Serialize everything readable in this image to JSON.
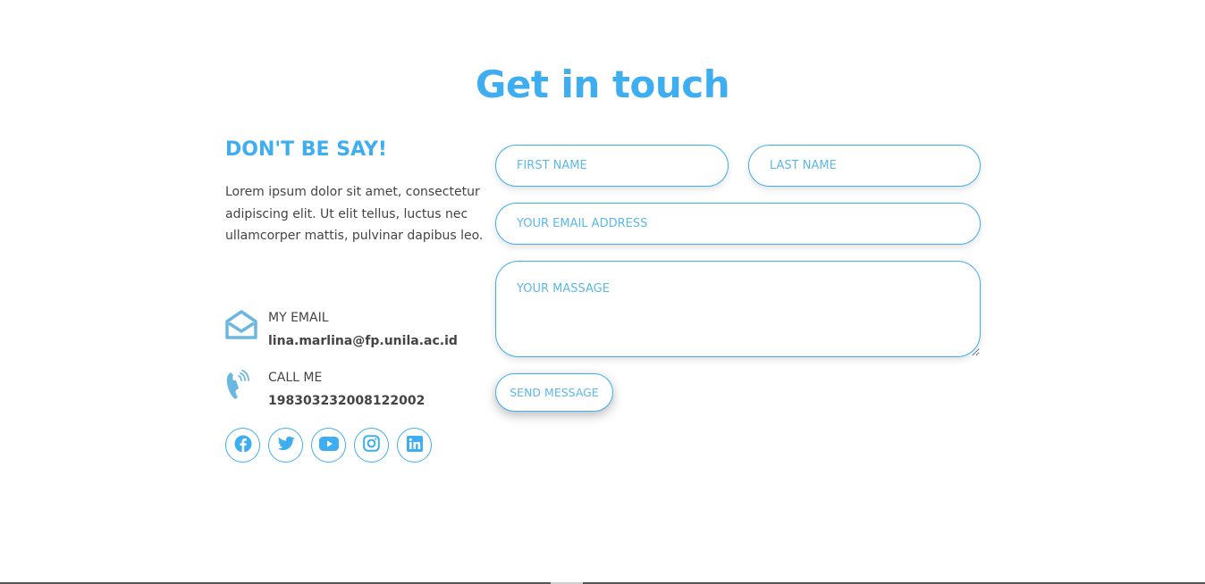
{
  "section": {
    "title": "Get in touch"
  },
  "left": {
    "heading": "DON'T BE SAY!",
    "body": "Lorem ipsum dolor sit amet, consectetur adipiscing elit. Ut elit tellus, luctus nec ullamcorper mattis, pulvinar dapibus leo.",
    "email_label": "MY EMAIL",
    "email_value": "lina.marlina@fp.unila.ac.id",
    "phone_label": "CALL ME",
    "phone_value": "198303232008122002",
    "socials": [
      "facebook-icon",
      "twitter-icon",
      "youtube-icon",
      "instagram-icon",
      "linkedin-icon"
    ]
  },
  "form": {
    "first_name_placeholder": "FIRST NAME",
    "last_name_placeholder": "LAST NAME",
    "email_placeholder": "YOUR EMAIL ADDRESS",
    "message_placeholder": "YOUR MASSAGE",
    "submit_label": "SEND MESSAGE"
  },
  "colors": {
    "accent": "#3eaef0",
    "text": "#444444",
    "icon": "#6cb7e0"
  }
}
